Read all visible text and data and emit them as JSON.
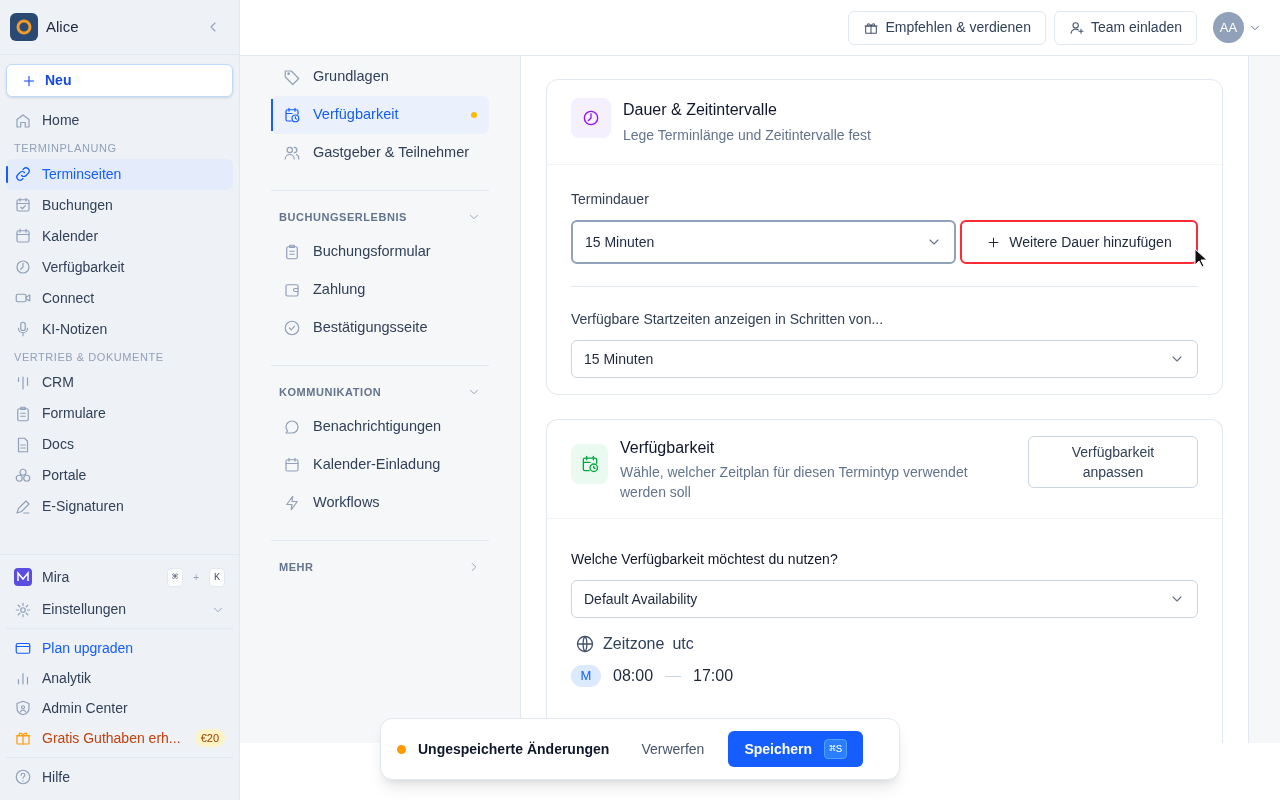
{
  "sidebar": {
    "workspace": "Alice",
    "new_button": "Neu",
    "nav": [
      {
        "kind": "item",
        "label": "Home",
        "selected": false
      },
      {
        "kind": "heading",
        "label": "TERMINPLANUNG"
      },
      {
        "kind": "item",
        "label": "Terminseiten",
        "selected": true
      },
      {
        "kind": "item",
        "label": "Buchungen",
        "selected": false
      },
      {
        "kind": "item",
        "label": "Kalender",
        "selected": false
      },
      {
        "kind": "item",
        "label": "Verfügbarkeit",
        "selected": false
      },
      {
        "kind": "item",
        "label": "Connect",
        "selected": false
      },
      {
        "kind": "item",
        "label": "KI-Notizen",
        "selected": false
      },
      {
        "kind": "heading",
        "label": "VERTRIEB & DOKUMENTE"
      },
      {
        "kind": "item",
        "label": "CRM",
        "selected": false
      },
      {
        "kind": "item",
        "label": "Formulare",
        "selected": false
      },
      {
        "kind": "item",
        "label": "Docs",
        "selected": false
      },
      {
        "kind": "item",
        "label": "Portale",
        "selected": false
      },
      {
        "kind": "item",
        "label": "E-Signaturen",
        "selected": false
      }
    ],
    "mira": {
      "label": "Mira",
      "keys": [
        "⌘",
        "K"
      ],
      "joiner": "+"
    },
    "settings": {
      "label": "Einstellungen",
      "expanded": false
    },
    "bottom": [
      {
        "kind": "upgrade",
        "label": "Plan upgraden"
      },
      {
        "kind": "item",
        "label": "Analytik"
      },
      {
        "kind": "item",
        "label": "Admin Center"
      },
      {
        "kind": "promo",
        "label": "Gratis Guthaben erh...",
        "badge": "€20"
      }
    ],
    "help": "Hilfe"
  },
  "topbar": {
    "buttons": [
      "Empfehlen & verdienen",
      "Team einladen"
    ],
    "avatar": "AA"
  },
  "subnav": {
    "items": [
      {
        "label": "Grundlagen",
        "selected": false,
        "unsaved": false
      },
      {
        "label": "Verfügbarkeit",
        "selected": true,
        "unsaved": true
      },
      {
        "label": "Gastgeber & Teilnehmer",
        "selected": false,
        "unsaved": false
      }
    ],
    "sections": [
      {
        "title": "BUCHUNGSERLEBNIS",
        "expanded": true,
        "items": [
          "Buchungsformular",
          "Zahlung",
          "Bestätigungsseite"
        ]
      },
      {
        "title": "KOMMUNIKATION",
        "expanded": true,
        "items": [
          "Benachrichtigungen",
          "Kalender-Einladung",
          "Workflows"
        ]
      },
      {
        "title": "MEHR",
        "expanded": false
      }
    ]
  },
  "duration_card": {
    "title": "Dauer & Zeitintervalle",
    "subtitle": "Lege Terminlänge und Zeitintervalle fest",
    "duration_label": "Termindauer",
    "duration_value": "15 Minuten",
    "add_button": "Weitere Dauer hinzufügen",
    "step_label": "Verfügbare Startzeiten anzeigen in Schritten von...",
    "step_value": "15 Minuten"
  },
  "availability_card": {
    "title": "Verfügbarkeit",
    "subtitle": "Wähle, welcher Zeitplan für diesen Termintyp verwendet werden soll",
    "button": "Verfügbarkeit anpassen",
    "question": "Welche Verfügbarkeit möchtest du nutzen?",
    "schedule": "Default Availability",
    "timezone_label": "Zeitzone",
    "timezone": "utc",
    "day": "M",
    "from": "08:00",
    "to": "17:00"
  },
  "save_bar": {
    "message": "Ungespeicherte Änderungen",
    "discard": "Verwerfen",
    "save": "Speichern",
    "shortcut": "⌘S"
  }
}
